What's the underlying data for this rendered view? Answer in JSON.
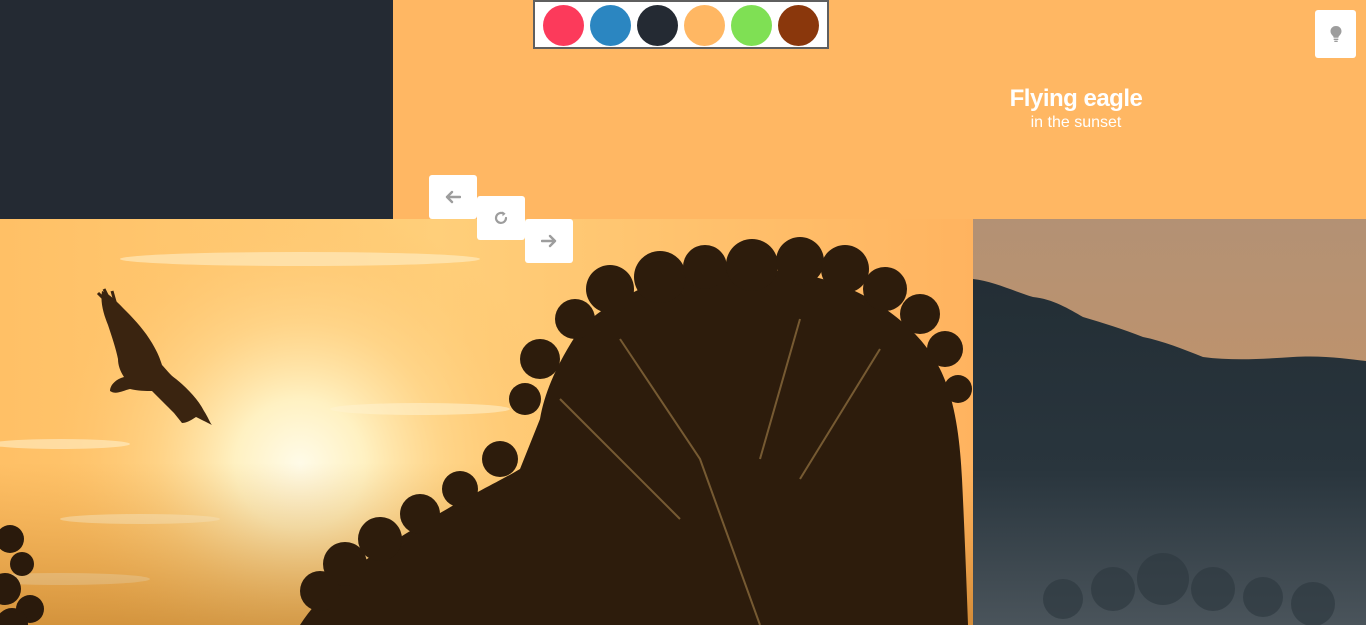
{
  "colors": {
    "dark_panel": "#242a33",
    "orange_panel": "#ffb763"
  },
  "palette": {
    "swatches": [
      {
        "name": "red",
        "color": "#fc3a5b"
      },
      {
        "name": "blue",
        "color": "#2b86c1"
      },
      {
        "name": "dark",
        "color": "#242a33"
      },
      {
        "name": "orange",
        "color": "#ffb763"
      },
      {
        "name": "green",
        "color": "#7fe054"
      },
      {
        "name": "brown",
        "color": "#8a370c"
      }
    ]
  },
  "caption": {
    "title": "Flying eagle",
    "subtitle": "in the sunset"
  },
  "controls": {
    "prev_icon": "arrow-left-icon",
    "reload_icon": "reload-icon",
    "next_icon": "arrow-right-icon",
    "tip_icon": "lightbulb-icon"
  },
  "photos": {
    "main": "eagle-sunset-photo",
    "side": "misty-forest-photo"
  }
}
